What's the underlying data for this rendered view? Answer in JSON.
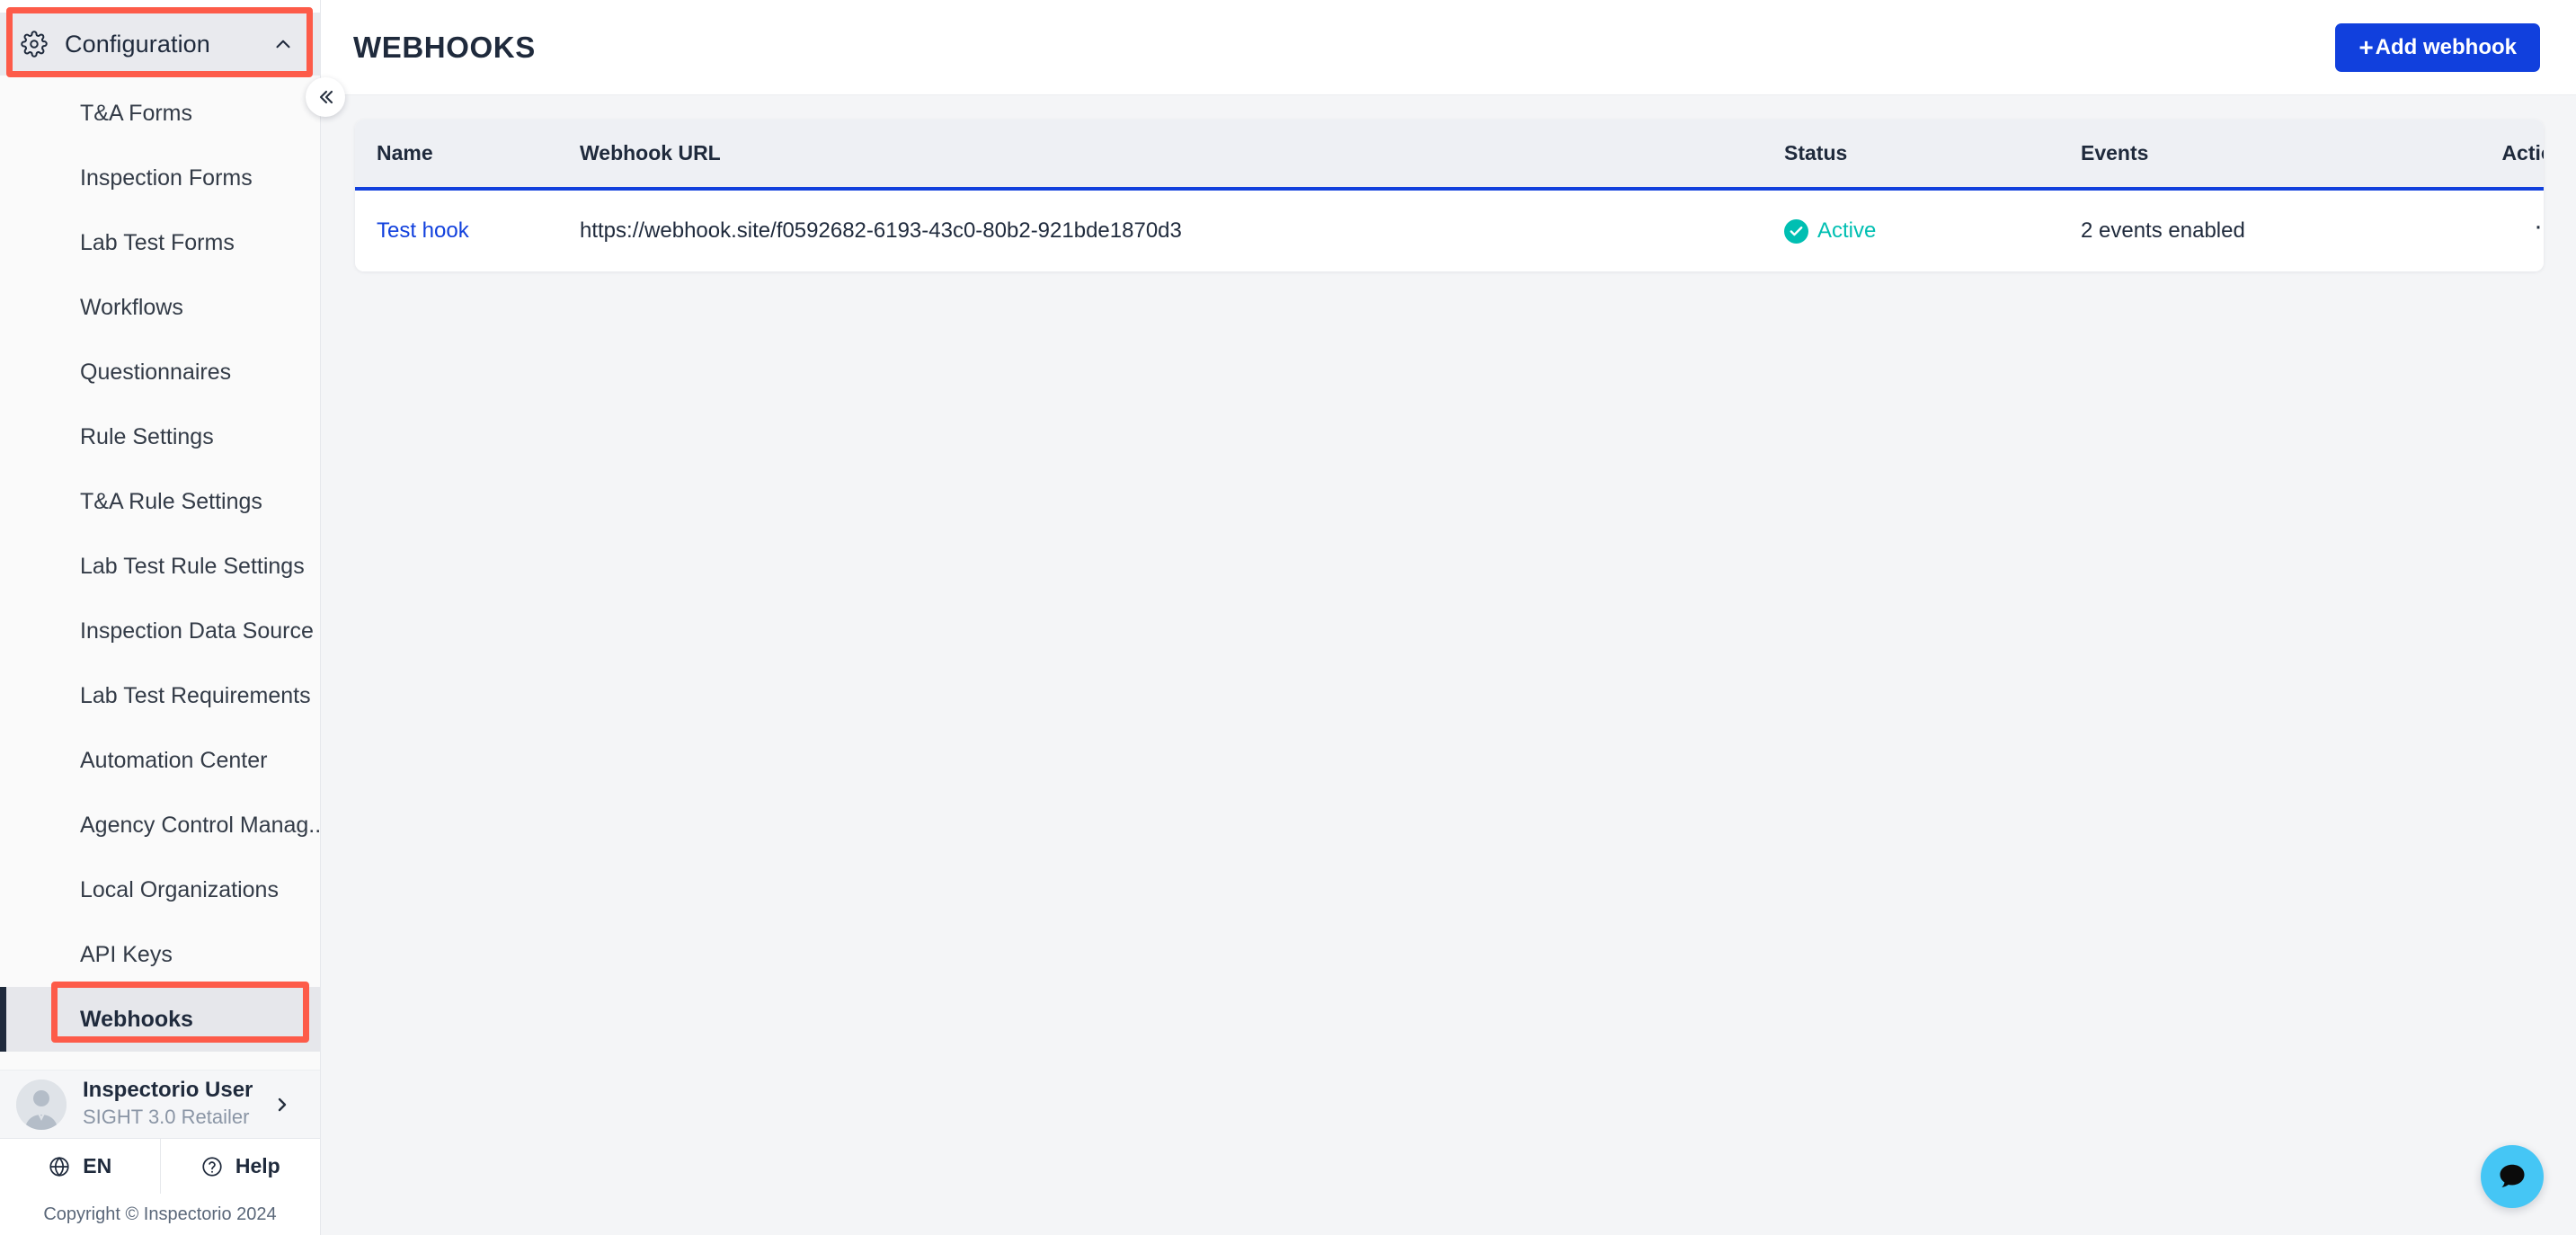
{
  "sidebar": {
    "header": {
      "label": "Configuration",
      "icon": "gear-icon",
      "chevron": "chevron-up-icon"
    },
    "collapse": {
      "icon": "double-chevron-left-icon"
    },
    "items": [
      {
        "label": "T&A Forms",
        "active": false,
        "expandable": false
      },
      {
        "label": "Inspection Forms",
        "active": false,
        "expandable": false
      },
      {
        "label": "Lab Test Forms",
        "active": false,
        "expandable": false
      },
      {
        "label": "Workflows",
        "active": false,
        "expandable": false
      },
      {
        "label": "Questionnaires",
        "active": false,
        "expandable": false
      },
      {
        "label": "Rule Settings",
        "active": false,
        "expandable": false
      },
      {
        "label": "T&A Rule Settings",
        "active": false,
        "expandable": false
      },
      {
        "label": "Lab Test Rule Settings",
        "active": false,
        "expandable": false
      },
      {
        "label": "Inspection Data Source",
        "active": false,
        "expandable": false
      },
      {
        "label": "Lab Test Requirements",
        "active": false,
        "expandable": true
      },
      {
        "label": "Automation Center",
        "active": false,
        "expandable": false
      },
      {
        "label": "Agency Control Manag...",
        "active": false,
        "expandable": false
      },
      {
        "label": "Local Organizations",
        "active": false,
        "expandable": false
      },
      {
        "label": "API Keys",
        "active": false,
        "expandable": false
      },
      {
        "label": "Webhooks",
        "active": true,
        "expandable": false
      }
    ],
    "user": {
      "name": "Inspectorio User",
      "role": "SIGHT 3.0 Retailer",
      "chevron": "chevron-right-icon"
    },
    "actions": [
      {
        "label": "EN",
        "icon": "globe-icon"
      },
      {
        "label": "Help",
        "icon": "question-circle-icon"
      }
    ],
    "copyright": "Copyright © Inspectorio 2024"
  },
  "header": {
    "title": "WEBHOOKS",
    "add_button": {
      "label": "Add webhook",
      "plus": "+"
    }
  },
  "table": {
    "columns": [
      "Name",
      "Webhook URL",
      "Status",
      "Events",
      "Action"
    ],
    "rows": [
      {
        "name": "Test hook",
        "url": "https://webhook.site/f0592682-6193-43c0-80b2-921bde1870d3",
        "status": "Active",
        "events": "2 events enabled",
        "action": "···"
      }
    ]
  },
  "chat": {
    "icon": "chat-bubble-icon"
  },
  "colors": {
    "accent_blue": "#1140dd",
    "status_active": "#00bfb2",
    "annotation_red": "#fd5b49",
    "sidebar_active_bar": "#1f2a3c",
    "chat_bubble": "#45c6f5"
  }
}
